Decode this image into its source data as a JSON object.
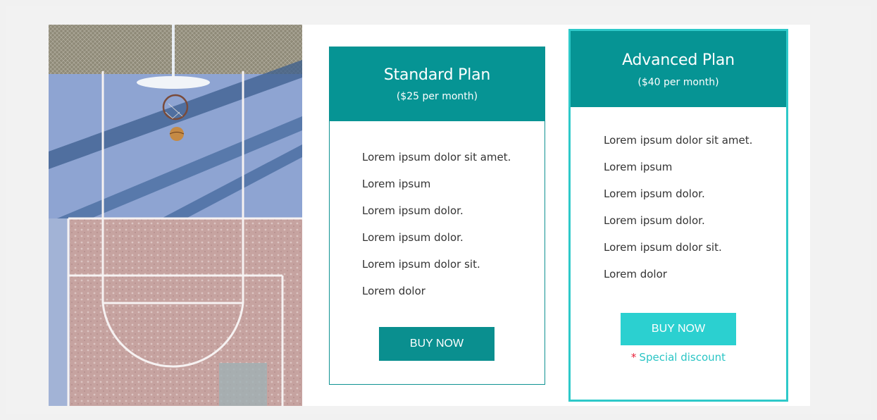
{
  "plans": [
    {
      "title": "Standard Plan",
      "price": "($25 per month)",
      "features": [
        "Lorem ipsum dolor sit amet.",
        "Lorem ipsum",
        "Lorem ipsum dolor.",
        "Lorem ipsum dolor.",
        "Lorem ipsum dolor sit.",
        "Lorem dolor"
      ],
      "button_label": "BUY NOW"
    },
    {
      "title": "Advanced Plan",
      "price": "($40 per month)",
      "features": [
        "Lorem ipsum dolor sit amet.",
        "Lorem ipsum",
        "Lorem ipsum dolor.",
        "Lorem ipsum dolor.",
        "Lorem ipsum dolor sit.",
        "Lorem dolor"
      ],
      "button_label": "BUY NOW",
      "discount_marker": "*",
      "discount_text": "Special discount"
    }
  ],
  "colors": {
    "header_teal": "#069494",
    "advanced_border": "#2ec9c9",
    "advanced_button": "#2bd0d0",
    "discount_text": "#2ac5c5",
    "discount_star": "#e8203a"
  },
  "image": {
    "subject": "aerial view of a basketball court"
  }
}
